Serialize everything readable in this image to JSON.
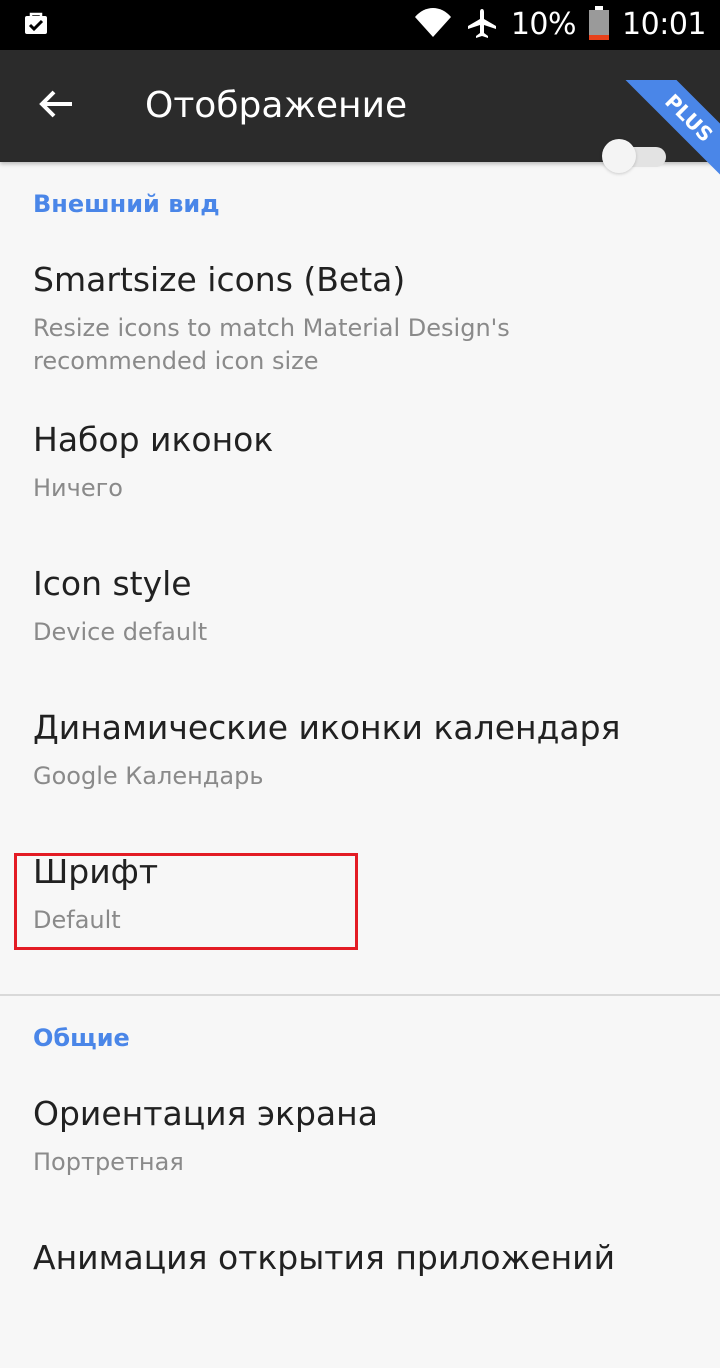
{
  "status_bar": {
    "left_icon": "briefcase-check-icon",
    "battery_percent": "10%",
    "time": "10:01",
    "wifi_icon": "wifi-icon",
    "airplane_icon": "airplane-icon",
    "battery_icon": "battery-low-icon"
  },
  "app_bar": {
    "title": "Отображение",
    "back_icon": "arrow-back-icon"
  },
  "sections": [
    {
      "header": "Внешний вид",
      "items": [
        {
          "title": "Smartsize icons (Beta)",
          "summary": "Resize icons to match Material Design's recommended icon size",
          "toggle_state": "off",
          "badge": "PLUS"
        },
        {
          "title": "Набор иконок",
          "summary": "Ничего"
        },
        {
          "title": "Icon style",
          "summary": "Device default"
        },
        {
          "title": "Динамические иконки календаря",
          "summary": "Google Календарь"
        },
        {
          "title": "Шрифт",
          "summary": "Default",
          "highlighted": true
        }
      ]
    },
    {
      "header": "Общие",
      "items": [
        {
          "title": "Ориентация экрана",
          "summary": "Портретная"
        },
        {
          "title": "Анимация открытия приложений",
          "summary": ""
        }
      ]
    }
  ],
  "colors": {
    "accent": "#4a86e8",
    "app_bar": "#2b2b2b",
    "status_bar": "#000000",
    "background": "#f7f7f7",
    "highlight": "#e31c24"
  }
}
